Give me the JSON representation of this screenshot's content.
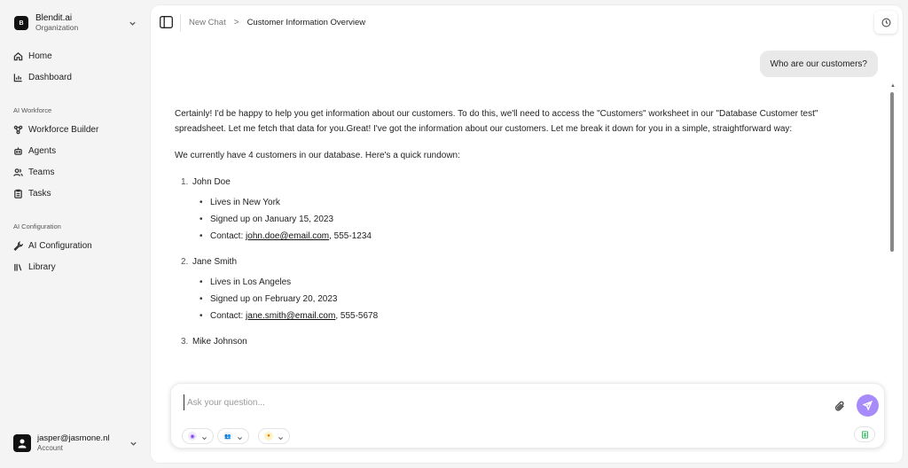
{
  "org": {
    "logo_letter": "B",
    "name": "Blendit.ai",
    "sub": "Organization"
  },
  "nav": {
    "home": "Home",
    "dashboard": "Dashboard",
    "section_workforce": "AI Workforce",
    "workforce_builder": "Workforce Builder",
    "agents": "Agents",
    "teams": "Teams",
    "tasks": "Tasks",
    "section_config": "AI Configuration",
    "ai_configuration": "AI Configuration",
    "library": "Library"
  },
  "account": {
    "email": "jasper@jasmone.nl",
    "sub": "Account"
  },
  "breadcrumb": {
    "parent": "New Chat",
    "separator": ">",
    "current": "Customer Information Overview"
  },
  "chat": {
    "user_message": "Who are our customers?",
    "intro": "Certainly! I'd be happy to help you get information about our customers. To do this, we'll need to access the \"Customers\" worksheet in our \"Database Customer test\" spreadsheet. Let me fetch that data for you.Great! I've got the information about our customers. Let me break it down for you in a simple, straightforward way:",
    "summary": "We currently have 4 customers in our database. Here's a quick rundown:",
    "customers": [
      {
        "num": "1.",
        "name": "John Doe",
        "city": "Lives in New York",
        "signup": "Signed up on January 15, 2023",
        "contact_label": "Contact: ",
        "email": "john.doe@email.com",
        "phone": ", 555-1234"
      },
      {
        "num": "2.",
        "name": "Jane Smith",
        "city": "Lives in Los Angeles",
        "signup": "Signed up on February 20, 2023",
        "contact_label": "Contact: ",
        "email": "jane.smith@email.com",
        "phone": ", 555-5678"
      },
      {
        "num": "3.",
        "name": "Mike Johnson"
      }
    ]
  },
  "composer": {
    "placeholder": "Ask your question..."
  },
  "colors": {
    "send_button": "#a78bfa",
    "sidebar_bg": "#f4f4f5",
    "bubble_bg": "#e9e9ea"
  }
}
